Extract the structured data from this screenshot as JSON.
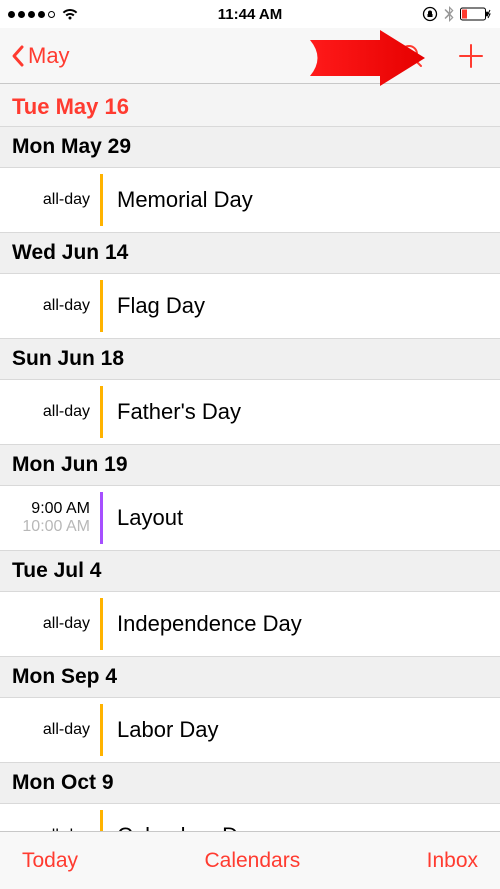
{
  "status": {
    "time": "11:44 AM"
  },
  "nav": {
    "back_label": "May"
  },
  "current_day": "Tue  May 16",
  "sections": [
    {
      "header": "Mon  May 29",
      "events": [
        {
          "t1": "all-day",
          "t2": "",
          "color": "orange",
          "title": "Memorial Day"
        }
      ]
    },
    {
      "header": "Wed  Jun 14",
      "events": [
        {
          "t1": "all-day",
          "t2": "",
          "color": "orange",
          "title": "Flag Day"
        }
      ]
    },
    {
      "header": "Sun  Jun 18",
      "events": [
        {
          "t1": "all-day",
          "t2": "",
          "color": "orange",
          "title": "Father's Day"
        }
      ]
    },
    {
      "header": "Mon  Jun 19",
      "events": [
        {
          "t1": "9:00 AM",
          "t2": "10:00 AM",
          "color": "purple",
          "title": "Layout"
        }
      ]
    },
    {
      "header": "Tue  Jul 4",
      "events": [
        {
          "t1": "all-day",
          "t2": "",
          "color": "orange",
          "title": "Independence Day"
        }
      ]
    },
    {
      "header": "Mon  Sep 4",
      "events": [
        {
          "t1": "all-day",
          "t2": "",
          "color": "orange",
          "title": "Labor Day"
        }
      ]
    },
    {
      "header": "Mon  Oct 9",
      "events": [
        {
          "t1": "all-day",
          "t2": "",
          "color": "orange",
          "title": "Columbus Day"
        }
      ]
    }
  ],
  "bottom": {
    "today": "Today",
    "calendars": "Calendars",
    "inbox": "Inbox"
  }
}
